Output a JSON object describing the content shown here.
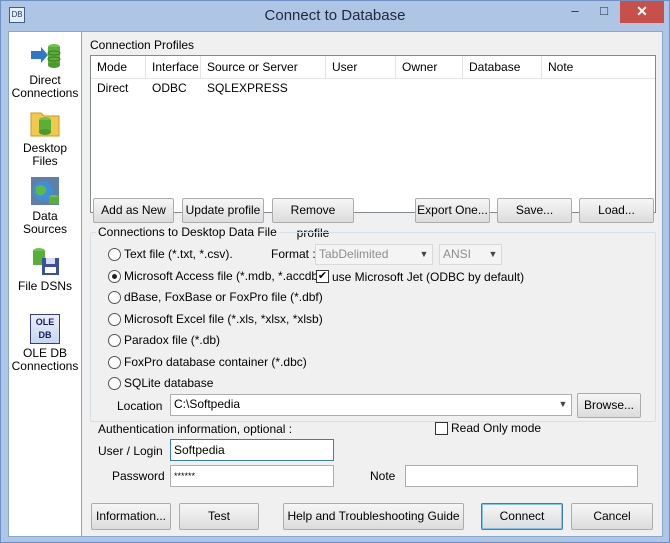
{
  "window": {
    "title": "Connect to Database",
    "icon_text": "DB",
    "min_label": "–",
    "max_label": "□",
    "close_label": "✕"
  },
  "sidebar": {
    "items": [
      {
        "label_l1": "Direct",
        "label_l2": "Connections"
      },
      {
        "label_l1": "Desktop",
        "label_l2": "Files"
      },
      {
        "label_l1": "Data",
        "label_l2": "Sources"
      },
      {
        "label_l1": "File DSNs",
        "label_l2": ""
      },
      {
        "label_l1": "OLE DB",
        "label_l2": "Connections",
        "icon_text": "OLE DB"
      }
    ]
  },
  "profiles": {
    "group_label": "Connection Profiles",
    "columns": [
      "Mode",
      "Interface",
      "Source or Server",
      "User",
      "Owner",
      "Database",
      "Note"
    ],
    "rows": [
      [
        "Direct",
        "ODBC",
        "SQLEXPRESS",
        "",
        "",
        "",
        ""
      ]
    ],
    "buttons": {
      "add": "Add as New",
      "update": "Update profile",
      "remove": "Remove profile",
      "export": "Export One...",
      "save": "Save...",
      "load": "Load..."
    }
  },
  "desktop_file": {
    "group_label": "Connections to Desktop Data File",
    "options": [
      "Text file (*.txt, *.csv).",
      "Microsoft Access file (*.mdb, *.accdb)",
      "dBase, FoxBase or FoxPro file (*.dbf)",
      "Microsoft Excel file (*.xls, *xlsx, *xlsb)",
      "Paradox file (*.db)",
      "FoxPro database container (*.dbc)",
      "SQLite database"
    ],
    "selected_index": 1,
    "format_label": "Format :",
    "format_value": "TabDelimited",
    "charset_value": "ANSI",
    "use_jet_label": "use Microsoft Jet (ODBC by default)",
    "use_jet_checked": true,
    "location_label": "Location",
    "location_value": "C:\\Softpedia",
    "browse_label": "Browse..."
  },
  "auth": {
    "label": "Authentication information, optional :",
    "read_only_label": "Read Only mode",
    "read_only_checked": false,
    "user_label": "User / Login",
    "user_value": "Softpedia",
    "password_label": "Password",
    "password_value": "******",
    "note_label": "Note",
    "note_value": ""
  },
  "footer": {
    "information": "Information...",
    "test": "Test",
    "help": "Help and Troubleshooting Guide",
    "connect": "Connect",
    "cancel": "Cancel"
  }
}
